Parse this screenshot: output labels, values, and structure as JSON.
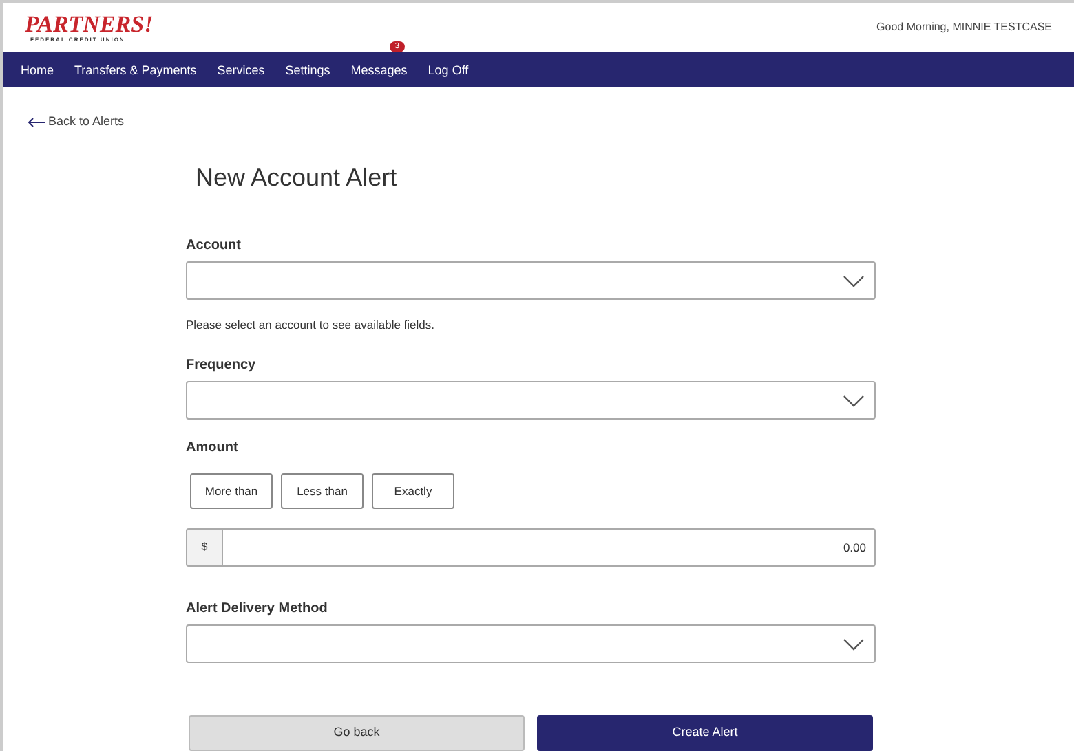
{
  "logo": {
    "name": "PARTNERS!",
    "subtitle": "FEDERAL CREDIT UNION"
  },
  "greeting": "Good Morning, MINNIE TESTCASE",
  "nav": [
    {
      "label": "Home"
    },
    {
      "label": "Transfers & Payments"
    },
    {
      "label": "Services"
    },
    {
      "label": "Settings"
    },
    {
      "label": "Messages",
      "badge": "3"
    },
    {
      "label": "Log Off"
    }
  ],
  "back_link": "Back to Alerts",
  "title": "New Account Alert",
  "account": {
    "label": "Account",
    "hint": "Please select an account to see available fields."
  },
  "frequency": {
    "label": "Frequency"
  },
  "amount": {
    "label": "Amount",
    "options": [
      {
        "label": "More than",
        "selected": false
      },
      {
        "label": "Less than",
        "selected": false
      },
      {
        "label": "Exactly",
        "selected": false
      }
    ],
    "prefix": "$",
    "placeholder": "0.00"
  },
  "delivery": {
    "label": "Alert Delivery Method"
  },
  "buttons": [
    {
      "label": "Go back",
      "kind": "secondary"
    },
    {
      "label": "Create Alert",
      "kind": "primary"
    }
  ]
}
